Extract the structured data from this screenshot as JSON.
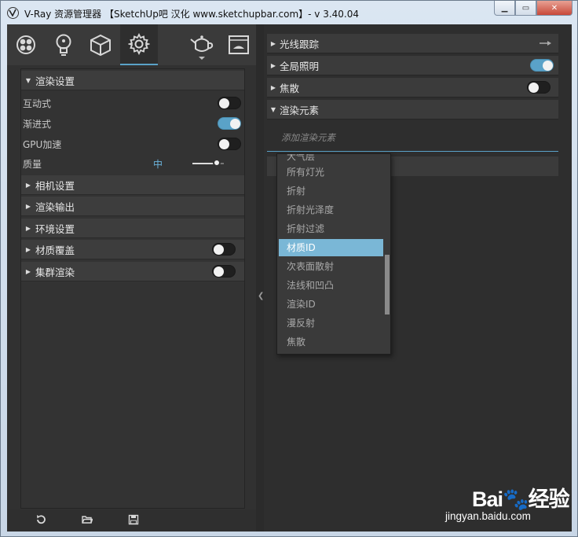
{
  "window": {
    "title": "V-Ray 资源管理器 【SketchUp吧 汉化 www.sketchupbar.com】- v 3.40.04",
    "minimize_icon": "minimize-icon",
    "maximize_icon": "maximize-icon",
    "close_icon": "close-icon"
  },
  "tabs": [
    {
      "icon": "materials-icon"
    },
    {
      "icon": "lights-icon"
    },
    {
      "icon": "geometry-icon"
    },
    {
      "icon": "settings-icon",
      "active": true
    },
    {
      "icon": "teapot-render-icon"
    },
    {
      "icon": "frame-buffer-icon"
    }
  ],
  "left": {
    "render_settings": {
      "title": "渲染设置",
      "interactive": {
        "label": "互动式",
        "on": false
      },
      "progressive": {
        "label": "渐进式",
        "on": true
      },
      "gpu": {
        "label": "GPU加速",
        "on": false
      },
      "quality": {
        "label": "质量",
        "value": "中",
        "level": 0.8
      }
    },
    "sections": [
      {
        "title": "相机设置"
      },
      {
        "title": "渲染输出"
      },
      {
        "title": "环境设置"
      },
      {
        "title": "材质覆盖",
        "toggle": false
      },
      {
        "title": "集群渲染",
        "toggle": false
      }
    ],
    "footer": [
      "revert-icon",
      "open-folder-icon",
      "save-icon"
    ]
  },
  "right": {
    "sections": [
      {
        "title": "光线跟踪"
      },
      {
        "title": "全局照明",
        "toggle": true
      },
      {
        "title": "焦散",
        "toggle": false
      },
      {
        "title": "渲染元素",
        "expanded": true
      }
    ],
    "add_element_placeholder": "添加渲染元素",
    "dropdown": {
      "items": [
        "大气层",
        "所有灯光",
        "折射",
        "折射光泽度",
        "折射过滤",
        "材质ID",
        "次表面散射",
        "法线和凹凸",
        "渲染ID",
        "漫反射",
        "焦散"
      ],
      "selected": "材质ID"
    }
  },
  "watermark": {
    "brand": "Bai🐾经验",
    "url": "jingyan.baidu.com"
  },
  "colors": {
    "accent": "#5aa2c8",
    "selection": "#7ab7d6",
    "panel": "#333333",
    "background": "#2e2e2e"
  }
}
